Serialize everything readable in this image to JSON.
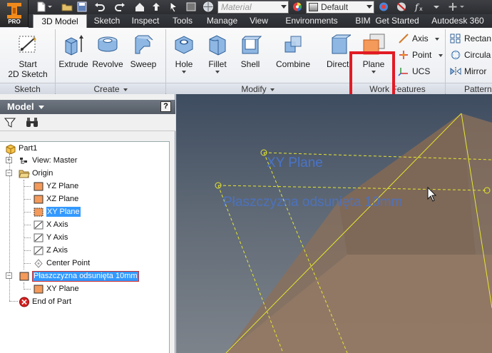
{
  "quick_access": {
    "material_placeholder": "Material",
    "appearance_value": "Default",
    "app_badge": "PRO"
  },
  "tabs": [
    "3D Model",
    "Sketch",
    "Inspect",
    "Tools",
    "Manage",
    "View",
    "Environments",
    "BIM",
    "Get Started",
    "Autodesk 360"
  ],
  "ribbon": {
    "sketch_panel": {
      "start_label_1": "Start",
      "start_label_2": "2D Sketch",
      "panel": "Sketch"
    },
    "create_panel": {
      "extrude": "Extrude",
      "revolve": "Revolve",
      "sweep": "Sweep",
      "panel": "Create"
    },
    "modify_panel": {
      "hole": "Hole",
      "fillet": "Fillet",
      "shell": "Shell",
      "combine": "Combine",
      "direct": "Direct",
      "panel": "Modify"
    },
    "work_features_panel": {
      "plane": "Plane",
      "axis": "Axis",
      "point": "Point",
      "ucs": "UCS",
      "panel": "Work Features"
    },
    "pattern_panel": {
      "rectangular": "Rectan",
      "circular": "Circula",
      "mirror": "Mirror",
      "panel": "Pattern"
    }
  },
  "browser": {
    "title": "Model",
    "help": "?",
    "tree": [
      {
        "label": "Part1"
      },
      {
        "label": "View: Master"
      },
      {
        "label": "Origin"
      },
      {
        "label": "YZ Plane"
      },
      {
        "label": "XZ Plane"
      },
      {
        "label": "XY Plane"
      },
      {
        "label": "X Axis"
      },
      {
        "label": "Y Axis"
      },
      {
        "label": "Z Axis"
      },
      {
        "label": "Center Point"
      },
      {
        "label": "Płaszczyzna odsunięta 10mm"
      },
      {
        "label": "XY Plane"
      },
      {
        "label": "End of Part"
      }
    ]
  },
  "viewport": {
    "xy_label": "XY Plane",
    "offset_label": "Płaszczyzna odsunięta 10mm"
  },
  "colors": {
    "accent_highlight": "#e21b24",
    "selection": "#3399ff",
    "plane_label": "#4a74c9",
    "plane_outline": "#e6e62e"
  }
}
